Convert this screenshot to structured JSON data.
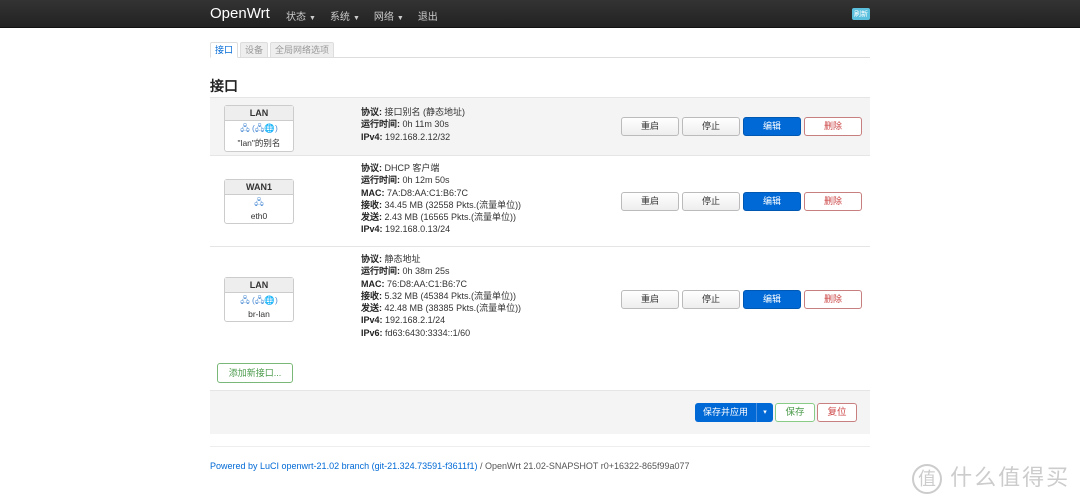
{
  "header": {
    "brand": "OpenWrt",
    "menu": [
      "状态",
      "系统",
      "网络"
    ],
    "logout": "退出",
    "badge": "刷新"
  },
  "tabs": [
    "接口",
    "设备",
    "全局网络选项"
  ],
  "title": "接口",
  "interfaces": [
    {
      "name": "LAN",
      "icons": "🖧 (🖧🌐)",
      "device": "\"lan\"的别名",
      "lines": [
        [
          "协议:",
          "接口别名 (静态地址)"
        ],
        [
          "运行时间:",
          "0h 11m 30s"
        ],
        [
          "IPv4:",
          "192.168.2.12/32"
        ]
      ]
    },
    {
      "name": "WAN1",
      "icons": "🖧",
      "device": "eth0",
      "lines": [
        [
          "协议:",
          "DHCP 客户端"
        ],
        [
          "运行时间:",
          "0h 12m 50s"
        ],
        [
          "MAC:",
          "7A:D8:AA:C1:B6:7C"
        ],
        [
          "接收:",
          "34.45 MB (32558 Pkts.(流量单位))"
        ],
        [
          "发送:",
          "2.43 MB (16565 Pkts.(流量单位))"
        ],
        [
          "IPv4:",
          "192.168.0.13/24"
        ]
      ]
    },
    {
      "name": "LAN",
      "icons": "🖧 (🖧🌐)",
      "device": "br-lan",
      "lines": [
        [
          "协议:",
          "静态地址"
        ],
        [
          "运行时间:",
          "0h 38m 25s"
        ],
        [
          "MAC:",
          "76:D8:AA:C1:B6:7C"
        ],
        [
          "接收:",
          "5.32 MB (45384 Pkts.(流量单位))"
        ],
        [
          "发送:",
          "42.48 MB (38385 Pkts.(流量单位))"
        ],
        [
          "IPv4:",
          "192.168.2.1/24"
        ],
        [
          "IPv6:",
          "fd63:6430:3334::1/60"
        ]
      ]
    }
  ],
  "row_buttons": {
    "restart": "重启",
    "stop": "停止",
    "edit": "编辑",
    "delete": "删除"
  },
  "add_button": "添加新接口...",
  "actions": {
    "save_apply": "保存并应用",
    "dropdown": "▾",
    "save": "保存",
    "reset": "复位"
  },
  "footer": {
    "link": "Powered by LuCI openwrt-21.02 branch (git-21.324.73591-f3611f1)",
    "rest": " / OpenWrt 21.02-SNAPSHOT r0+16322-865f99a077"
  },
  "watermark": {
    "circle": "值",
    "text": "什么值得买"
  }
}
